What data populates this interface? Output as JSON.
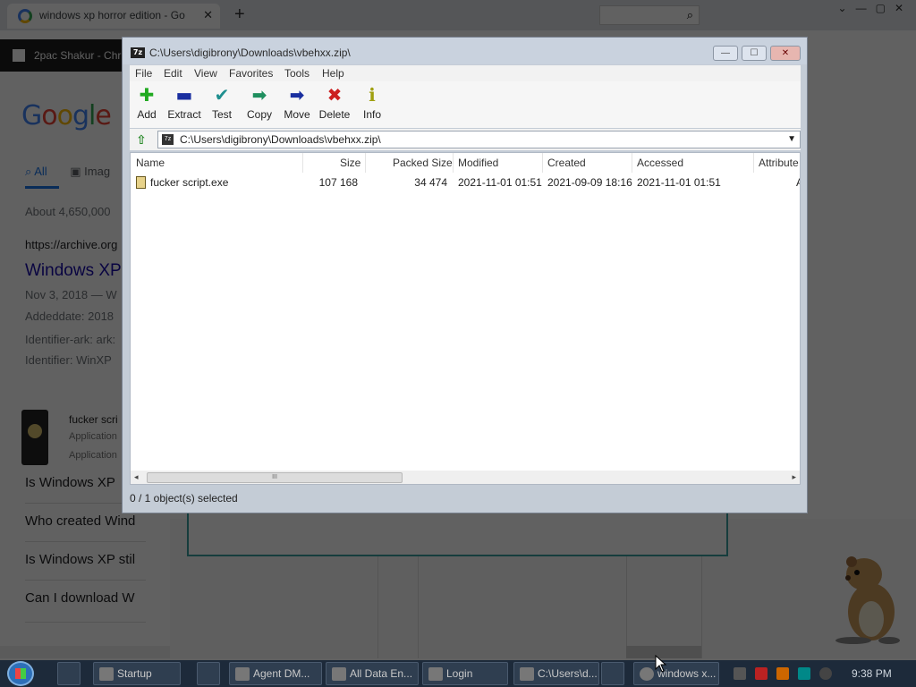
{
  "browser": {
    "tabs": [
      {
        "title": "windows xp horror edition - Go",
        "close": "✕"
      },
      {
        "title": "",
        "close": ""
      }
    ],
    "new_tab": "+",
    "bookmark_dark": "2pac Shakur - Chr",
    "search_tabs": {
      "all": "All",
      "images": "Imag"
    },
    "google_logo": {
      "g1": "G",
      "o1": "o",
      "o2": "o",
      "g2": "g",
      "l": "l",
      "e": "e"
    },
    "results_count": "About 4,650,000",
    "result_url": "https://archive.org",
    "result_title": "Windows XP",
    "result_date": "Nov 3, 2018 — W",
    "result_added": "Addeddate: 2018",
    "result_ident_ark": "Identifier-ark: ark:",
    "result_ident": "Identifier: WinXP",
    "file_card": {
      "name": "fucker scri",
      "type1": "Application",
      "type2": "Application"
    },
    "people_also_ask": [
      "Is Windows XP",
      "Who created Wind",
      "Is Windows XP stil",
      "Can I download W"
    ]
  },
  "sevenzip": {
    "title": "C:\\Users\\digibrony\\Downloads\\vbehxx.zip\\",
    "title_icon": "7z",
    "window_buttons": {
      "min": "—",
      "max": "☐",
      "close": "✕"
    },
    "menu": [
      "File",
      "Edit",
      "View",
      "Favorites",
      "Tools",
      "Help"
    ],
    "toolbar": [
      {
        "label": "Add",
        "icon": "plus-icon",
        "glyph": "✚",
        "color": "#22aa22"
      },
      {
        "label": "Extract",
        "icon": "minus-icon",
        "glyph": "▬",
        "color": "#1a2fa0"
      },
      {
        "label": "Test",
        "icon": "check-icon",
        "glyph": "✔",
        "color": "#1f8f8f"
      },
      {
        "label": "Copy",
        "icon": "copy-arrow-icon",
        "glyph": "➡",
        "color": "#1f8f5f"
      },
      {
        "label": "Move",
        "icon": "move-arrow-icon",
        "glyph": "➡",
        "color": "#1a2fa0"
      },
      {
        "label": "Delete",
        "icon": "delete-x-icon",
        "glyph": "✖",
        "color": "#cc1f1f"
      },
      {
        "label": "Info",
        "icon": "info-icon",
        "glyph": "ℹ",
        "color": "#a0a010"
      }
    ],
    "address": "C:\\Users\\digibrony\\Downloads\\vbehxx.zip\\",
    "columns": [
      "Name",
      "Size",
      "Packed Size",
      "Modified",
      "Created",
      "Accessed",
      "Attribute"
    ],
    "rows": [
      {
        "name": "fucker script.exe",
        "size": "107 168",
        "packed": "34 474",
        "modified": "2021-11-01 01:51",
        "created": "2021-09-09 18:16",
        "accessed": "2021-11-01 01:51",
        "attr": "A"
      }
    ],
    "status": "0 / 1 object(s) selected",
    "scroll_left": "◂",
    "scroll_right": "▸",
    "scroll_grip": "III"
  },
  "taskbar": {
    "items": [
      "Startup",
      "Agent DM...",
      "All Data En...",
      "Login",
      "C:\\Users\\d...",
      "windows x..."
    ],
    "clock": "9:38 PM"
  }
}
